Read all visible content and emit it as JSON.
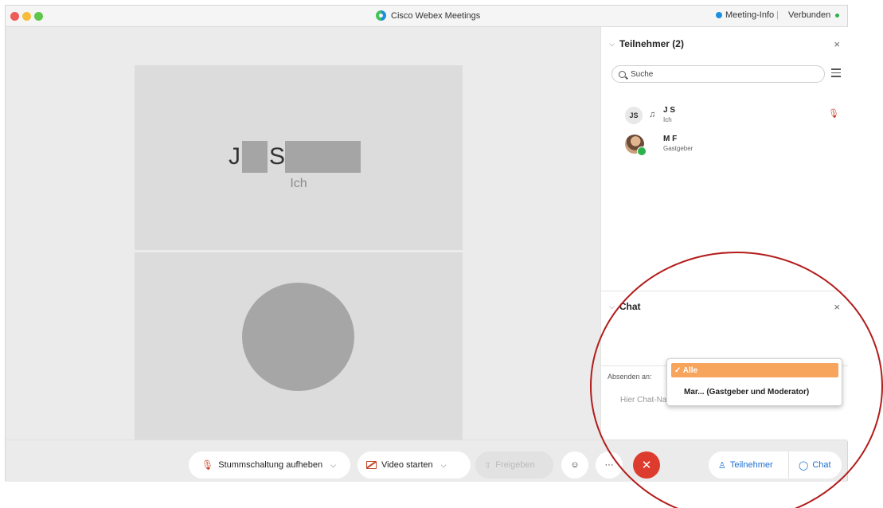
{
  "window": {
    "title": "Cisco Webex Meetings",
    "meeting_info": "Meeting-Info",
    "separator": "|",
    "status": "Verbunden"
  },
  "stage": {
    "self_tile": {
      "name_first": "J",
      "name_last": "S",
      "sub": "Ich"
    }
  },
  "participants": {
    "header": "Teilnehmer (2)",
    "search_placeholder": "Suche",
    "list": [
      {
        "initials": "JS",
        "name": "J   S",
        "role": "Ich"
      },
      {
        "name": "M      F",
        "role": "Gastgeber"
      }
    ]
  },
  "chat": {
    "header": "Chat",
    "send_to_label": "Absenden an:",
    "input_placeholder": "Hier Chat-Na",
    "dropdown_options": [
      {
        "label": "✓ Alle",
        "selected": true
      },
      {
        "label": "Mar... (Gastgeber und Moderator)",
        "selected": false
      }
    ]
  },
  "toolbar": {
    "unmute": "Stummschaltung aufheben",
    "video": "Video starten",
    "share": "Freigeben",
    "more": "···",
    "leave": "✕",
    "participants": "Teilnehmer",
    "chat": "Chat"
  },
  "colors": {
    "accent_orange": "#f7a45c",
    "leave_red": "#dc3b2e",
    "link_blue": "#1d6fd1",
    "annotation_red": "#b31b1b"
  }
}
